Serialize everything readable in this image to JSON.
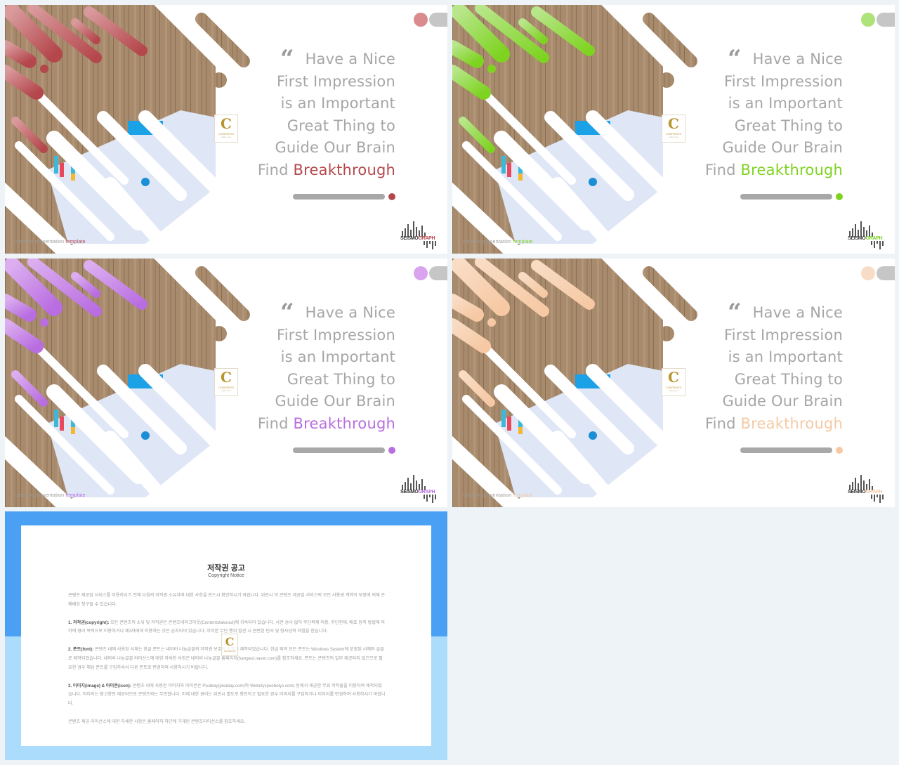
{
  "slides": [
    {
      "theme": "red",
      "accent": "#b4474c",
      "accent_light": "#d99a9c",
      "pager_dot": "#d98b8e",
      "quote_mark": "“",
      "quote_lines": [
        "Have a Nice",
        "First Impression",
        "is an Important",
        "Great Thing to",
        "Guide Our Brain"
      ],
      "find_prefix": "Find ",
      "accent_word": "Breakthrough",
      "footer_prefix": "creative presentation ",
      "footer_accent": "template",
      "logo_letter": "C",
      "logo_name": "CONTENTS",
      "logo_sub": "make your",
      "brand_prefix": "SEISMO",
      "brand_suffix": "GRAPH"
    },
    {
      "theme": "green",
      "accent": "#7ed321",
      "accent_light": "#b8e68a",
      "pager_dot": "#aee27a",
      "quote_mark": "“",
      "quote_lines": [
        "Have a Nice",
        "First Impression",
        "is an Important",
        "Great Thing to",
        "Guide Our Brain"
      ],
      "find_prefix": "Find ",
      "accent_word": "Breakthrough",
      "footer_prefix": "creative presentation ",
      "footer_accent": "template",
      "logo_letter": "C",
      "logo_name": "CONTENTS",
      "logo_sub": "make your",
      "brand_prefix": "SEISMO",
      "brand_suffix": "GRAPH"
    },
    {
      "theme": "purple",
      "accent": "#b86de0",
      "accent_light": "#dcaef0",
      "pager_dot": "#d9a3ef",
      "quote_mark": "“",
      "quote_lines": [
        "Have a Nice",
        "First Impression",
        "is an Important",
        "Great Thing to",
        "Guide Our Brain"
      ],
      "find_prefix": "Find ",
      "accent_word": "Breakthrough",
      "footer_prefix": "creative presentation ",
      "footer_accent": "template",
      "logo_letter": "C",
      "logo_name": "CONTENTS",
      "logo_sub": "make your",
      "brand_prefix": "SEISMO",
      "brand_suffix": "GRAPH"
    },
    {
      "theme": "peach",
      "accent": "#f6c9a4",
      "accent_light": "#f9dcc4",
      "pager_dot": "#f9dcc6",
      "quote_mark": "“",
      "quote_lines": [
        "Have a Nice",
        "First Impression",
        "is an Important",
        "Great Thing to",
        "Guide Our Brain"
      ],
      "find_prefix": "Find ",
      "accent_word": "Breakthrough",
      "footer_prefix": "creative presentation ",
      "footer_accent": "template",
      "logo_letter": "C",
      "logo_name": "CONTENTS",
      "logo_sub": "make your",
      "brand_prefix": "SEISMO",
      "brand_suffix": "GRAPH"
    }
  ],
  "copyright": {
    "title": "저작권 공고",
    "subtitle": "Copyright Notice",
    "intro": "콘텐츠 제공업 서비스를 이용하시기 전에 다음의 저작권 소유자에 대한 사항을 반드시 확인하시기 바랍니다. 위반시 이 콘텐츠 제공업 서비스의 모든 사용권 계약이 보장에 의해 손해배상 청구될 수 있습니다.",
    "sections": [
      {
        "label": "1. 저작권(copyright):",
        "text": " 모든 콘텐츠의 소유 및 저작권은 콘텐츠테이크아웃(Contentstakeout)에 귀속되어 있습니다. 사전 승낙 없이 무단복제 이용, 무단전재, 배포 등의 방법에 의하여 영리 목적으로 이용하거나 제3자에게 이용하는 것은 금지되어 있습니다. 이러한 무단 행위 발견 시 관련된 민사 및 형사상의 처벌을 받습니다."
      },
      {
        "label": "2. 폰트(font):",
        "text": " 콘텐츠 내에 사용된 서체는 한글 폰트는 네이버 나눔글꼴의 저작권 보호에 의하여 제작되었습니다. 한글 외의 모든 폰트는 Windows System에 포함된 서체와 글꼴로 제작되었습니다. 네이버 나눔글꼴 라이선스에 대한 자세한 사항은 네이버 나눔글꼴 홈페이지(hangeul.naver.com)를 참조하세요. 폰트는 콘텐츠의 일부 제공되지 않으므로 필요한 경우 해당 폰트를 구입하셔서 다른 폰트로 변경하여 사용하시기 바랍니다."
      },
      {
        "label": "3. 이미지(image) & 아이콘(icon):",
        "text": " 콘텐츠 내에 사용된 이미지와 아이콘은 Pixabay(pixabay.com)와 Webolys(webolys.com) 등에서 제공한 무료 저작물을 이용하여 제작되었습니다. 이미지는 참고용만 제공되므로 콘텐츠와는 무관합니다. 이에 대한 권리는 위반시 별도로 확인하고 필요한 경우 이미지를 구입하거나 이미지를 변경하여 사용하시기 바랍니다."
      }
    ],
    "outro": "콘텐츠 제공 라이선스에 대한 자세한 사항은 홈페이지 하단에 기재된 콘텐츠라이선스를 참조하세요.",
    "logo_letter": "C",
    "logo_name": "CONTENTS",
    "band_top_color": "#4aa1f3",
    "band_bottom_color": "#acdcfb"
  }
}
